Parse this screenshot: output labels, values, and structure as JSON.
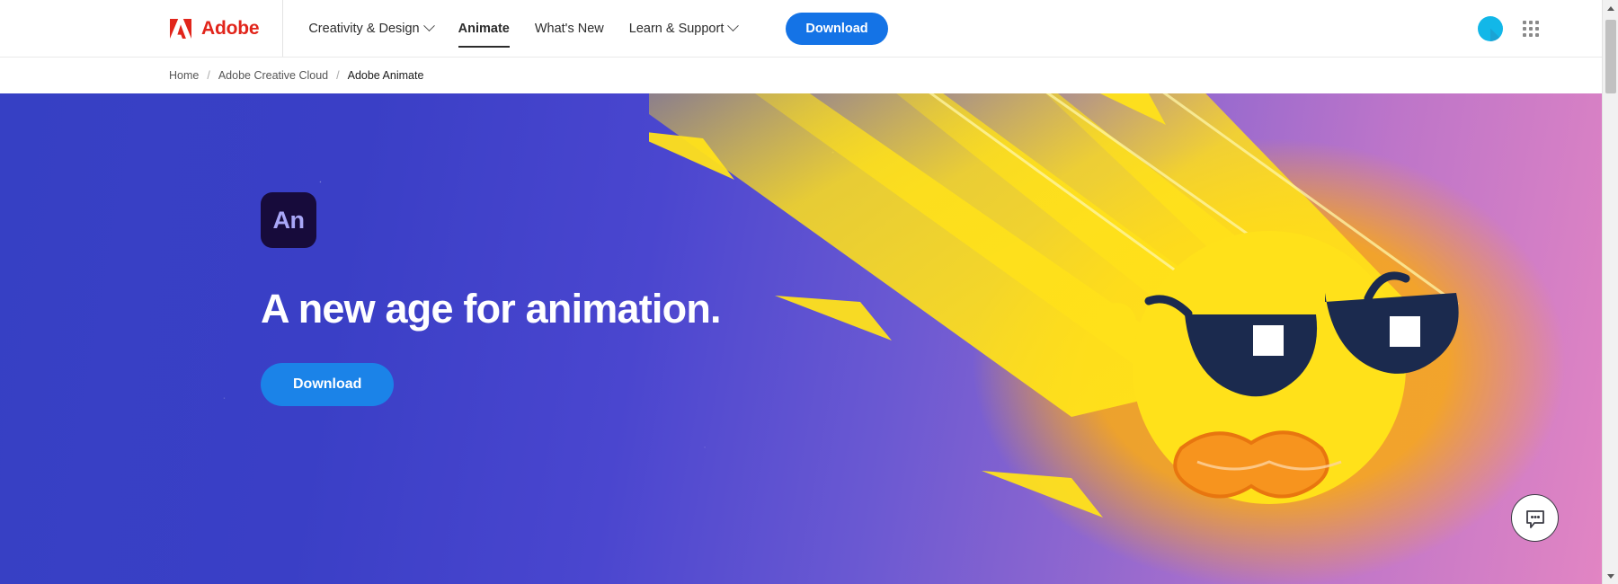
{
  "nav": {
    "brand": {
      "name": "Adobe",
      "logo_icon": "adobe-logo-icon",
      "color": "#e1251b"
    },
    "links": [
      {
        "label": "Creativity & Design",
        "has_caret": true,
        "active": false
      },
      {
        "label": "Animate",
        "has_caret": false,
        "active": true
      },
      {
        "label": "What's New",
        "has_caret": false,
        "active": false
      },
      {
        "label": "Learn & Support",
        "has_caret": true,
        "active": false
      }
    ],
    "cta_label": "Download",
    "cta_color": "#1473e6",
    "avatar_icon": "user-avatar-icon",
    "avatar_color": "#12b7e8",
    "app_switcher_icon": "app-grid-icon"
  },
  "breadcrumb": {
    "separator": "/",
    "items": [
      {
        "label": "Home",
        "current": false
      },
      {
        "label": "Adobe Creative Cloud",
        "current": false
      },
      {
        "label": "Adobe Animate",
        "current": true
      }
    ]
  },
  "hero": {
    "product_icon_text": "An",
    "product_icon_bg": "#170b3b",
    "product_icon_fg": "#a9a7f7",
    "title": "A new age for animation.",
    "cta_label": "Download",
    "cta_color": "#1b83e8",
    "gradient_from": "#3640c4",
    "gradient_mid": "#9268cf",
    "gradient_to": "#e285c3",
    "artwork": {
      "name": "comet-character-illustration",
      "comet_color": "#ffe11a",
      "glow_color": "#f39a1f",
      "sunglasses_color": "#1b2a4e",
      "mouth_color": "#f7941e"
    }
  },
  "chat_widget": {
    "icon": "chat-bubble-icon",
    "bg": "#ffffff",
    "border": "#3b3b44"
  },
  "scrollbar": {
    "up_icon": "scroll-up-arrow-icon",
    "down_icon": "scroll-down-arrow-icon",
    "thumb": "scrollbar-thumb"
  }
}
